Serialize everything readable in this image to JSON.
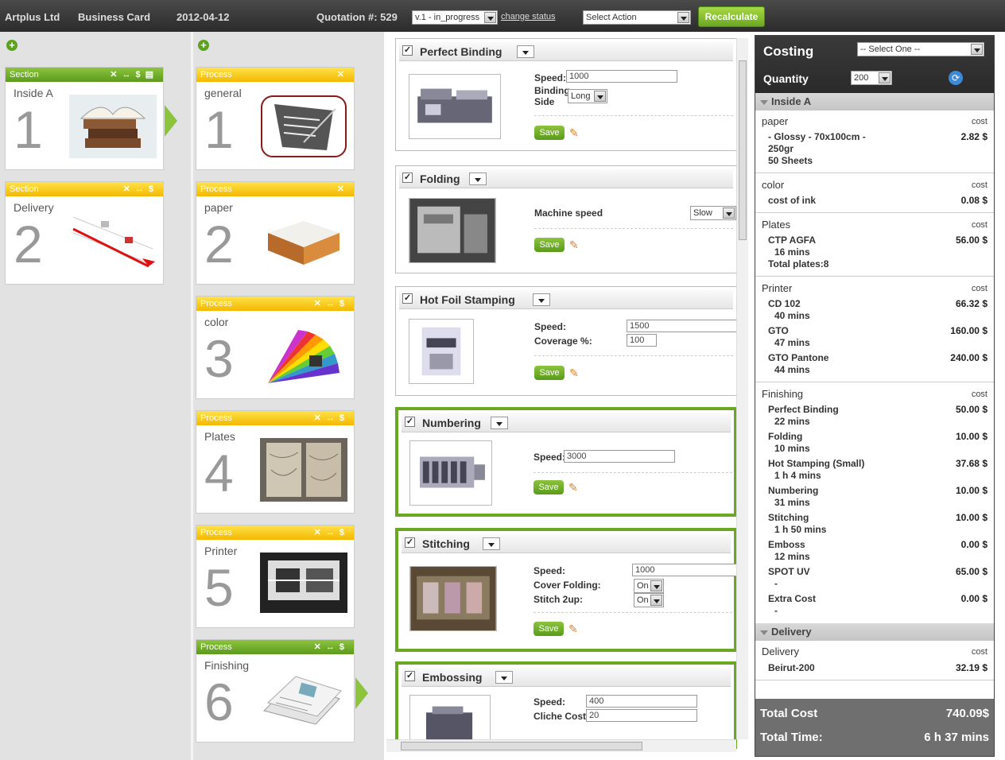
{
  "top": {
    "company": "Artplus Ltd",
    "product": "Business Card",
    "date": "2012-04-12",
    "quotation": "Quotation #: 529",
    "version": "v.1 - in_progress",
    "change_status": "change status",
    "action": "Select Action",
    "recalculate": "Recalculate"
  },
  "sections": [
    {
      "header": "Section",
      "title": "Inside A",
      "num": "1"
    },
    {
      "header": "Section",
      "title": "Delivery",
      "num": "2"
    }
  ],
  "processes": [
    {
      "header": "Process",
      "title": "general",
      "num": "1"
    },
    {
      "header": "Process",
      "title": "paper",
      "num": "2"
    },
    {
      "header": "Process",
      "title": "color",
      "num": "3"
    },
    {
      "header": "Process",
      "title": "Plates",
      "num": "4"
    },
    {
      "header": "Process",
      "title": "Printer",
      "num": "5"
    },
    {
      "header": "Process",
      "title": "Finishing",
      "num": "6"
    }
  ],
  "panels": {
    "binding": {
      "title": "Perfect Binding",
      "speed_label": "Speed:",
      "speed": "1000",
      "side_label1": "Binding",
      "side_label2": "Side",
      "side": "Long",
      "save": "Save"
    },
    "folding": {
      "title": "Folding",
      "speed_label": "Machine speed",
      "speed": "Slow",
      "save": "Save"
    },
    "foil": {
      "title": "Hot Foil Stamping",
      "speed_label": "Speed:",
      "speed": "1500",
      "cov_label": "Coverage %:",
      "cov": "100",
      "save": "Save"
    },
    "numbering": {
      "title": "Numbering",
      "speed_label": "Speed:",
      "speed": "3000",
      "save": "Save"
    },
    "stitching": {
      "title": "Stitching",
      "speed_label": "Speed:",
      "speed": "1000",
      "cover_label": "Cover Folding:",
      "cover": "On",
      "twoup_label": "Stitch 2up:",
      "twoup": "On",
      "save": "Save"
    },
    "embossing": {
      "title": "Embossing",
      "speed_label": "Speed:",
      "speed": "400",
      "cliche_label": "Cliche Cost:",
      "cliche": "20"
    }
  },
  "costing": {
    "title": "Costing",
    "select": "-- Select One --",
    "qty_label": "Quantity",
    "qty": "200",
    "groupA": "Inside A",
    "groupB": "Delivery",
    "cost": "cost",
    "paper": {
      "name": "paper",
      "l1": "- Glossy - 70x100cm -",
      "l2": "250gr",
      "l3": "50 Sheets",
      "amt": "2.82 $"
    },
    "color": {
      "name": "color",
      "l1": "cost of ink",
      "amt": "0.08 $"
    },
    "plates": {
      "name": "Plates",
      "l1": "CTP AGFA",
      "l2": "16 mins",
      "l3": "Total plates:8",
      "amt": "56.00 $"
    },
    "printer": {
      "name": "Printer",
      "a": "CD 102",
      "at": "40 mins",
      "aa": "66.32 $",
      "b": "GTO",
      "bt": "47 mins",
      "ba": "160.00 $",
      "c": "GTO Pantone",
      "ct": "44 mins",
      "ca": "240.00 $"
    },
    "finishing": {
      "name": "Finishing",
      "items": [
        {
          "n": "Perfect Binding",
          "t": "22 mins",
          "a": "50.00 $"
        },
        {
          "n": "Folding",
          "t": "10 mins",
          "a": "10.00 $"
        },
        {
          "n": "Hot Stamping (Small)",
          "t": "1 h 4 mins",
          "a": "37.68 $"
        },
        {
          "n": "Numbering",
          "t": "31 mins",
          "a": "10.00 $"
        },
        {
          "n": "Stitching",
          "t": "1 h 50 mins",
          "a": "10.00 $"
        },
        {
          "n": "Emboss",
          "t": "12 mins",
          "a": "0.00 $"
        },
        {
          "n": "SPOT UV",
          "t": "-",
          "a": "65.00 $"
        },
        {
          "n": "Extra Cost",
          "t": "-",
          "a": "0.00 $"
        }
      ]
    },
    "delivery": {
      "name": "Delivery",
      "l1": "Beirut-200",
      "amt": "32.19 $"
    },
    "total_cost_label": "Total Cost",
    "total_cost": "740.09$",
    "total_time_label": "Total Time:",
    "total_time": "6 h 37 mins"
  }
}
